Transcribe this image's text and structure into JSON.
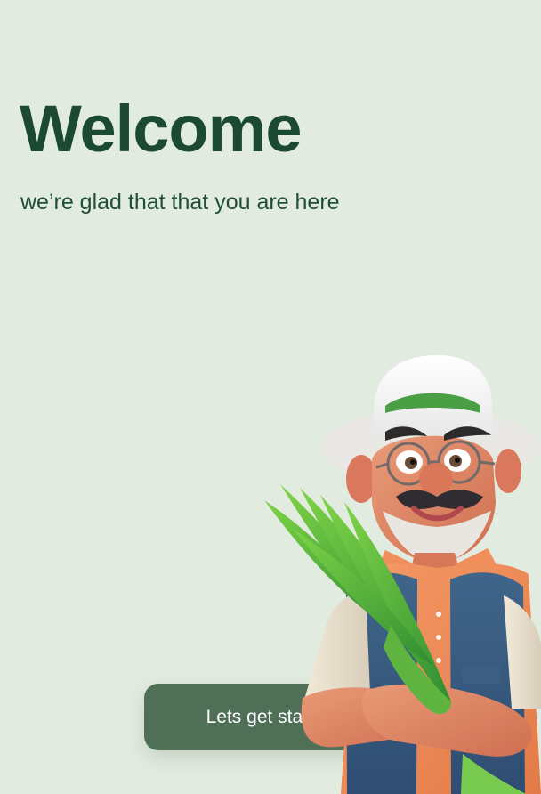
{
  "welcome": {
    "title": "Welcome",
    "subtitle": "we’re glad that that you are here"
  },
  "cta": {
    "label": "Lets get started"
  },
  "illustration": {
    "icon": "farmer-illustration"
  },
  "colors": {
    "background": "#e2ebe0",
    "title": "#1c4a31",
    "button": "#4f6f57",
    "button_text": "#ffffff"
  }
}
